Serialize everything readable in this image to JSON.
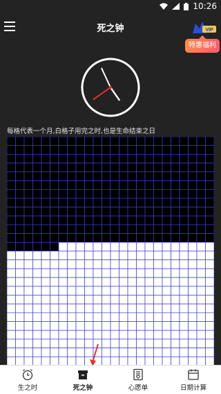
{
  "status_bar": {
    "time": "10:26"
  },
  "header": {
    "title": "死之钟",
    "vip_label": "VIP",
    "promo": "特惠福利"
  },
  "clock": {
    "hour_hand_angle_deg": 145,
    "minute_hand_angle_deg": 335,
    "second_hand_angle_deg": 235
  },
  "caption": "每格代表一个月,白格子用完之时,也是生命结束之日",
  "life_grid": {
    "columns": 24,
    "rows": 26,
    "used_full_rows": 12,
    "used_extra_cells": 6
  },
  "colors": {
    "used_cell": "#000000",
    "remaining_cell": "#ffffff",
    "grid_line": "#3b3bd6",
    "accent_red": "#e63030"
  },
  "bottom_nav": {
    "items": [
      {
        "label": "生之时",
        "icon": "alarm-clock-icon"
      },
      {
        "label": "死之钟",
        "icon": "box-icon"
      },
      {
        "label": "心愿单",
        "icon": "wish-list-icon"
      },
      {
        "label": "日期计算",
        "icon": "calendar-icon"
      }
    ],
    "active_index": 1
  }
}
